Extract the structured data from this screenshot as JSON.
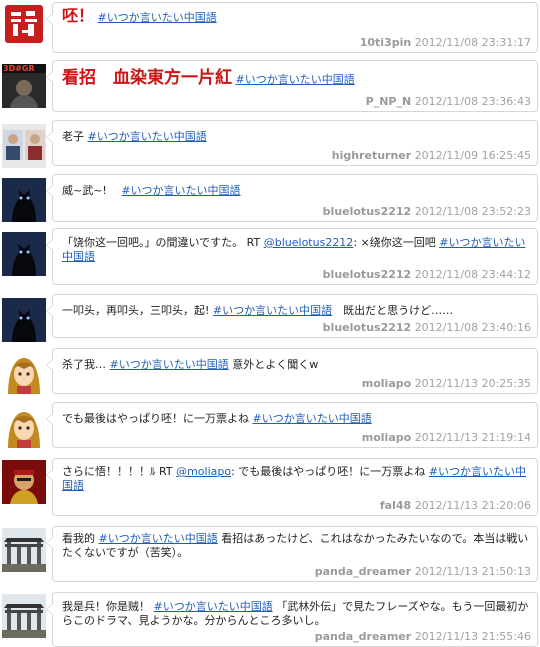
{
  "tweets": [
    {
      "big": "呸！",
      "tag": "#いつか言いたい中国語",
      "user": "10ti3pin",
      "time": "2012/11/08 23:31:17"
    },
    {
      "big": "看招　血染東方一片紅",
      "tag": "#いつか言いたい中国語",
      "user": "P_NP_N",
      "time": "2012/11/08 23:36:43",
      "avatar_text": "3D#GR"
    },
    {
      "pre": "老子 ",
      "tag": "#いつか言いたい中国語",
      "user": "highreturner",
      "time": "2012/11/09 16:25:45"
    },
    {
      "pre": "威~武~!　 ",
      "tag": "#いつか言いたい中国語",
      "user": "bluelotus2212",
      "time": "2012/11/08 23:52:23"
    },
    {
      "pre": "「饶你这一回吧。」の間違いですた。 RT ",
      "mention": "@bluelotus2212",
      "mid": ": ×绕你这一回吧 ",
      "tag": "#いつか言いたい中国語",
      "user": "bluelotus2212",
      "time": "2012/11/08 23:44:12"
    },
    {
      "pre": "一叩头，再叩头，三叩头，起! ",
      "tag": "#いつか言いたい中国語",
      "post": "　既出だと思うけど……",
      "user": "bluelotus2212",
      "time": "2012/11/08 23:40:16"
    },
    {
      "pre": "杀了我… ",
      "tag": "#いつか言いたい中国語",
      "post": " 意外とよく聞くw",
      "user": "moliapo",
      "time": "2012/11/13 20:25:35"
    },
    {
      "pre": "でも最後はやっぱり呸！に一万票よね ",
      "tag": "#いつか言いたい中国語",
      "user": "moliapo",
      "time": "2012/11/13 21:19:14"
    },
    {
      "pre": "さらに悟！！！！ﾙ RT ",
      "mention": "@moliapo",
      "mid": ": でも最後はやっぱり呸！に一万票よね ",
      "tag": "#いつか言いたい中国語",
      "user": "fal48",
      "time": "2012/11/13 21:20:06"
    },
    {
      "pre": "看我的 ",
      "tag": "#いつか言いたい中国語",
      "post": " 看招はあったけど、これはなかったみたいなので。本当は戦いたくないですが（苦笑）。",
      "user": "panda_dreamer",
      "time": "2012/11/13 21:50:13"
    },
    {
      "pre": "我是兵！你是贼！ ",
      "tag": "#いつか言いたい中国語",
      "post": " 「武林外伝」で見たフレーズやな。もう一回最初からこのドラマ、見ようかな。分からんところ多いし。",
      "user": "panda_dreamer",
      "time": "2012/11/13 21:55:46"
    }
  ],
  "colors": {
    "link": "#1f5eb8",
    "big_text": "#cc1414",
    "meta": "#a2a2a2",
    "border": "#d6d6d6"
  },
  "icons": [
    "seal-avatar-icon",
    "photo-avatar-icon",
    "cat-avatar-icon",
    "girl-avatar-icon",
    "gate-avatar-icon"
  ]
}
